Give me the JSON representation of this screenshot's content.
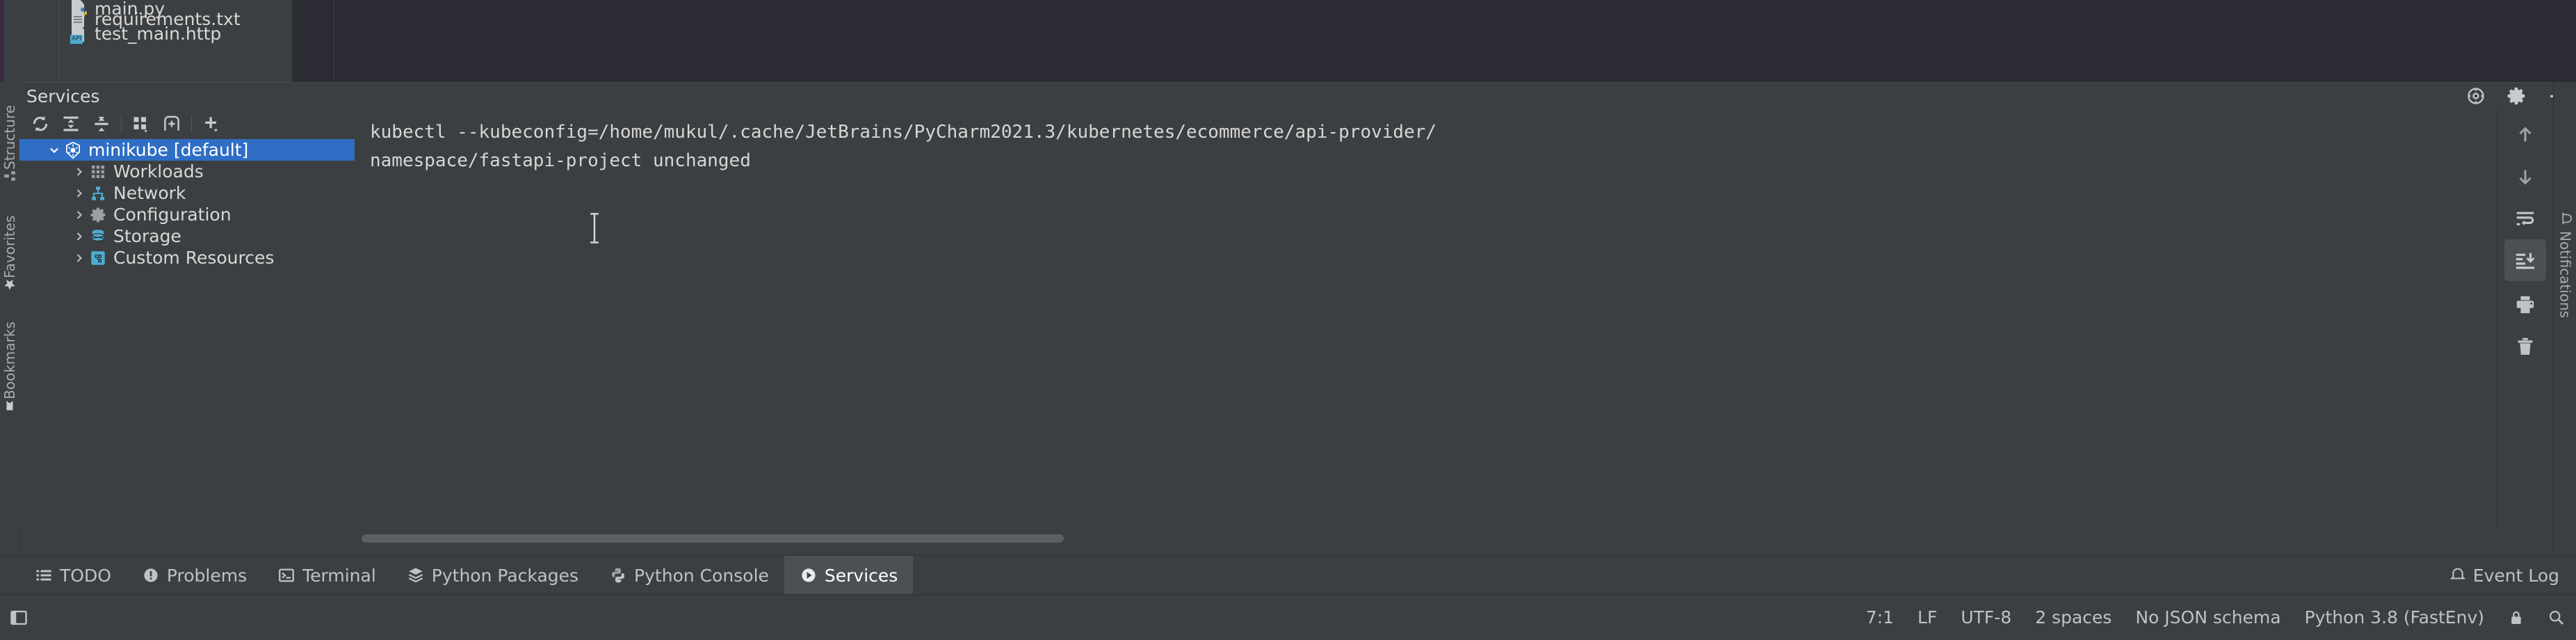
{
  "window": {
    "project_files": [
      {
        "name": "main.py",
        "icon": "python-file-icon"
      },
      {
        "name": "requirements.txt",
        "icon": "text-file-icon"
      },
      {
        "name": "test_main.http",
        "icon": "http-request-file-icon"
      }
    ]
  },
  "services_tool_window": {
    "title": "Services",
    "header_icons": [
      {
        "name": "hide-options-icon",
        "glyph": "settings-globe"
      },
      {
        "name": "settings-gear-icon",
        "glyph": "gear"
      },
      {
        "name": "minimize-icon",
        "glyph": "minus"
      }
    ],
    "toolbar": [
      {
        "name": "refresh-button",
        "icon": "refresh-icon"
      },
      {
        "name": "expand-all-button",
        "icon": "expand-all-icon"
      },
      {
        "name": "collapse-all-button",
        "icon": "collapse-all-icon"
      },
      {
        "name": "group-by-button",
        "icon": "group-by-icon"
      },
      {
        "name": "open-in-new-tab-button",
        "icon": "add-tab-icon"
      },
      {
        "name": "add-service-button",
        "icon": "plus-icon"
      }
    ],
    "tree": [
      {
        "label": "minikube [default]",
        "icon": "kubernetes-icon",
        "level": 0,
        "expanded": true,
        "selected": true
      },
      {
        "label": "Workloads",
        "icon": "workloads-icon",
        "level": 1,
        "expanded": false,
        "selected": false
      },
      {
        "label": "Network",
        "icon": "network-icon",
        "level": 1,
        "expanded": false,
        "selected": false
      },
      {
        "label": "Configuration",
        "icon": "configuration-icon",
        "level": 1,
        "expanded": false,
        "selected": false
      },
      {
        "label": "Storage",
        "icon": "storage-icon",
        "level": 1,
        "expanded": false,
        "selected": false
      },
      {
        "label": "Custom Resources",
        "icon": "custom-resources-icon",
        "level": 1,
        "expanded": false,
        "selected": false
      }
    ],
    "console": {
      "line1": "kubectl --kubeconfig=/home/mukul/.cache/JetBrains/PyCharm2021.3/kubernetes/ecommerce/api-provider/",
      "line2": "namespace/fastapi-project unchanged"
    },
    "console_rail": [
      {
        "name": "previous-occurrence-button",
        "icon": "arrow-up-icon",
        "active": false
      },
      {
        "name": "next-occurrence-button",
        "icon": "arrow-down-icon",
        "active": false
      },
      {
        "name": "soft-wrap-button",
        "icon": "soft-wrap-icon",
        "active": false
      },
      {
        "name": "scroll-to-end-button",
        "icon": "scroll-to-end-icon",
        "active": true
      },
      {
        "name": "print-button",
        "icon": "print-icon",
        "active": false
      },
      {
        "name": "clear-all-button",
        "icon": "trash-icon",
        "active": false
      }
    ],
    "notifications_label": "Notifications"
  },
  "left_tool_tabs": [
    {
      "label": "Structure",
      "icon": "structure-icon"
    },
    {
      "label": "Favorites",
      "icon": "star-icon"
    },
    {
      "label": "Bookmarks",
      "icon": "bookmark-icon"
    }
  ],
  "bottom_tabs": [
    {
      "label": "TODO",
      "icon": "todo-icon",
      "active": false
    },
    {
      "label": "Problems",
      "icon": "problems-icon",
      "active": false
    },
    {
      "label": "Terminal",
      "icon": "terminal-icon",
      "active": false
    },
    {
      "label": "Python Packages",
      "icon": "python-packages-icon",
      "active": false
    },
    {
      "label": "Python Console",
      "icon": "python-console-icon",
      "active": false
    },
    {
      "label": "Services",
      "icon": "services-icon",
      "active": true
    }
  ],
  "event_log": {
    "label": "Event Log",
    "icon": "event-log-icon"
  },
  "status_bar": {
    "caret_position": "7:1",
    "line_separator": "LF",
    "encoding": "UTF-8",
    "indent": "2 spaces",
    "schema": "No JSON schema",
    "interpreter": "Python 3.8 (FastEnv)",
    "icons": [
      {
        "name": "lock-icon"
      },
      {
        "name": "inspection-icon"
      }
    ]
  },
  "colors": {
    "accent_selection": "#2f6ec4",
    "panel_bg": "#3c3f41",
    "editor_bg": "#2b2b33",
    "text": "#d8d8d8",
    "kube_blue": "#4dacd0"
  }
}
